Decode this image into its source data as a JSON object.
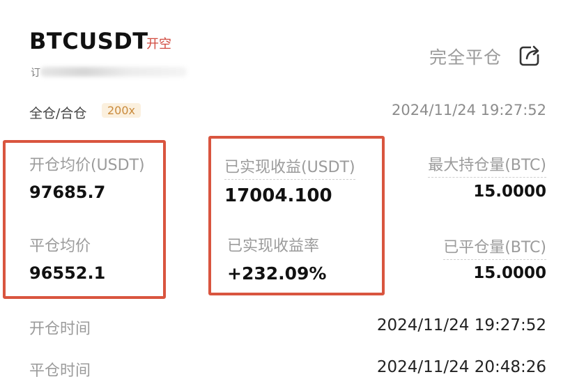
{
  "header": {
    "symbol": "BTCUSDT",
    "side": "开空",
    "close_all_label": "完全平仓",
    "share_icon": "share-icon",
    "blurred_prefix": "订"
  },
  "position": {
    "margin_mode": "全仓/合仓",
    "leverage": "200x",
    "timestamp": "2024/11/24 19:27:52"
  },
  "metrics": {
    "entry_avg_label": "开仓均价(USDT)",
    "entry_avg_value": "97685.7",
    "close_avg_label": "平仓均价",
    "close_avg_value": "96552.1",
    "realized_pnl_label": "已实现收益(USDT)",
    "realized_pnl_value": "17004.100",
    "realized_pnl_rate_label": "已实现收益率",
    "realized_pnl_rate_value": "+232.09%",
    "max_position_label": "最大持仓量(BTC)",
    "max_position_value": "15.0000",
    "closed_volume_label": "已平仓量(BTC)",
    "closed_volume_value": "15.0000"
  },
  "times": {
    "open_time_label": "开仓时间",
    "open_time_value": "2024/11/24 19:27:52",
    "close_time_label": "平仓时间",
    "close_time_value": "2024/11/24 20:48:26"
  },
  "colors": {
    "accent_red": "#d9553f",
    "side_tag": "#d14a3f",
    "leverage_text": "#c98a3c",
    "leverage_bg": "#fbf0de"
  }
}
